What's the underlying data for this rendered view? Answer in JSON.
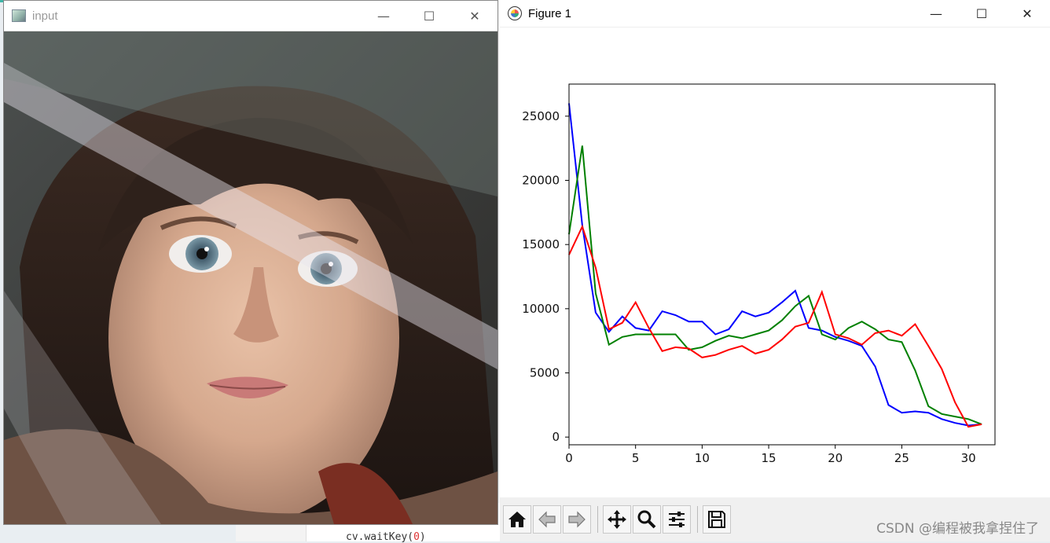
{
  "input_window": {
    "title": "input",
    "controls": {
      "minimize": "—",
      "maximize": "☐",
      "close": "✕"
    }
  },
  "figure_window": {
    "title": "Figure 1",
    "controls": {
      "minimize": "—",
      "maximize": "☐",
      "close": "✕"
    },
    "toolbar": [
      "home-icon",
      "back-arrow-icon",
      "forward-arrow-icon",
      "pan-icon",
      "zoom-icon",
      "configure-subplots-icon",
      "save-icon"
    ]
  },
  "background_editor": {
    "code_prefix": "cv.waitKey(",
    "code_arg": "0",
    "code_suffix": ")"
  },
  "watermark": "CSDN @编程被我拿捏住了",
  "chart_data": {
    "type": "line",
    "x": [
      0,
      1,
      2,
      3,
      4,
      5,
      6,
      7,
      8,
      9,
      10,
      11,
      12,
      13,
      14,
      15,
      16,
      17,
      18,
      19,
      20,
      21,
      22,
      23,
      24,
      25,
      26,
      27,
      28,
      29,
      30,
      31
    ],
    "xlim": [
      0,
      32
    ],
    "ylim": [
      -600,
      27500
    ],
    "xticks": [
      0,
      5,
      10,
      15,
      20,
      25,
      30
    ],
    "yticks": [
      0,
      5000,
      10000,
      15000,
      20000,
      25000
    ],
    "series": [
      {
        "color": "#0000ff",
        "values": [
          26000,
          16500,
          9700,
          8200,
          9400,
          8500,
          8300,
          9800,
          9500,
          9000,
          9000,
          8000,
          8400,
          9800,
          9400,
          9700,
          10500,
          11400,
          8500,
          8300,
          7800,
          7500,
          7100,
          5500,
          2500,
          1900,
          2000,
          1900,
          1400,
          1100,
          900,
          1000
        ]
      },
      {
        "color": "#008000",
        "values": [
          15800,
          22700,
          11200,
          7200,
          7800,
          8000,
          8000,
          8000,
          8000,
          6800,
          7000,
          7500,
          7900,
          7700,
          8000,
          8300,
          9100,
          10200,
          11000,
          8000,
          7600,
          8500,
          9000,
          8400,
          7600,
          7400,
          5200,
          2400,
          1800,
          1600,
          1400,
          1000
        ]
      },
      {
        "color": "#ff0000",
        "values": [
          14200,
          16400,
          13200,
          8400,
          8900,
          10500,
          8500,
          6700,
          7000,
          6900,
          6200,
          6400,
          6800,
          7100,
          6500,
          6800,
          7600,
          8600,
          8900,
          11300,
          8000,
          7700,
          7200,
          8100,
          8300,
          7900,
          8800,
          7100,
          5300,
          2700,
          800,
          1000
        ]
      }
    ]
  }
}
